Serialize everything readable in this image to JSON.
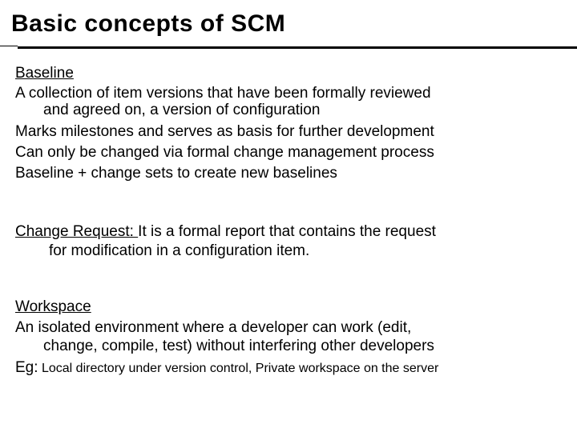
{
  "title": "Basic concepts of SCM",
  "baseline": {
    "heading": "Baseline",
    "lines": [
      "A collection of item versions that have been formally reviewed",
      "and agreed on, a version of configuration",
      "Marks milestones and serves as basis for further development",
      "Can only be changed via formal change management process",
      "Baseline + change sets to create new baselines"
    ]
  },
  "change_request": {
    "heading": "Change Request: ",
    "text_line1": "It is a formal report that contains the request",
    "text_line2": "for modification in a configuration item."
  },
  "workspace": {
    "heading": "Workspace",
    "lines": [
      "An isolated environment where a developer can work (edit,",
      "change, compile, test) without interfering other developers"
    ],
    "example_prefix": "Eg:",
    "example_text": " Local directory under version control, Private workspace on the server"
  }
}
